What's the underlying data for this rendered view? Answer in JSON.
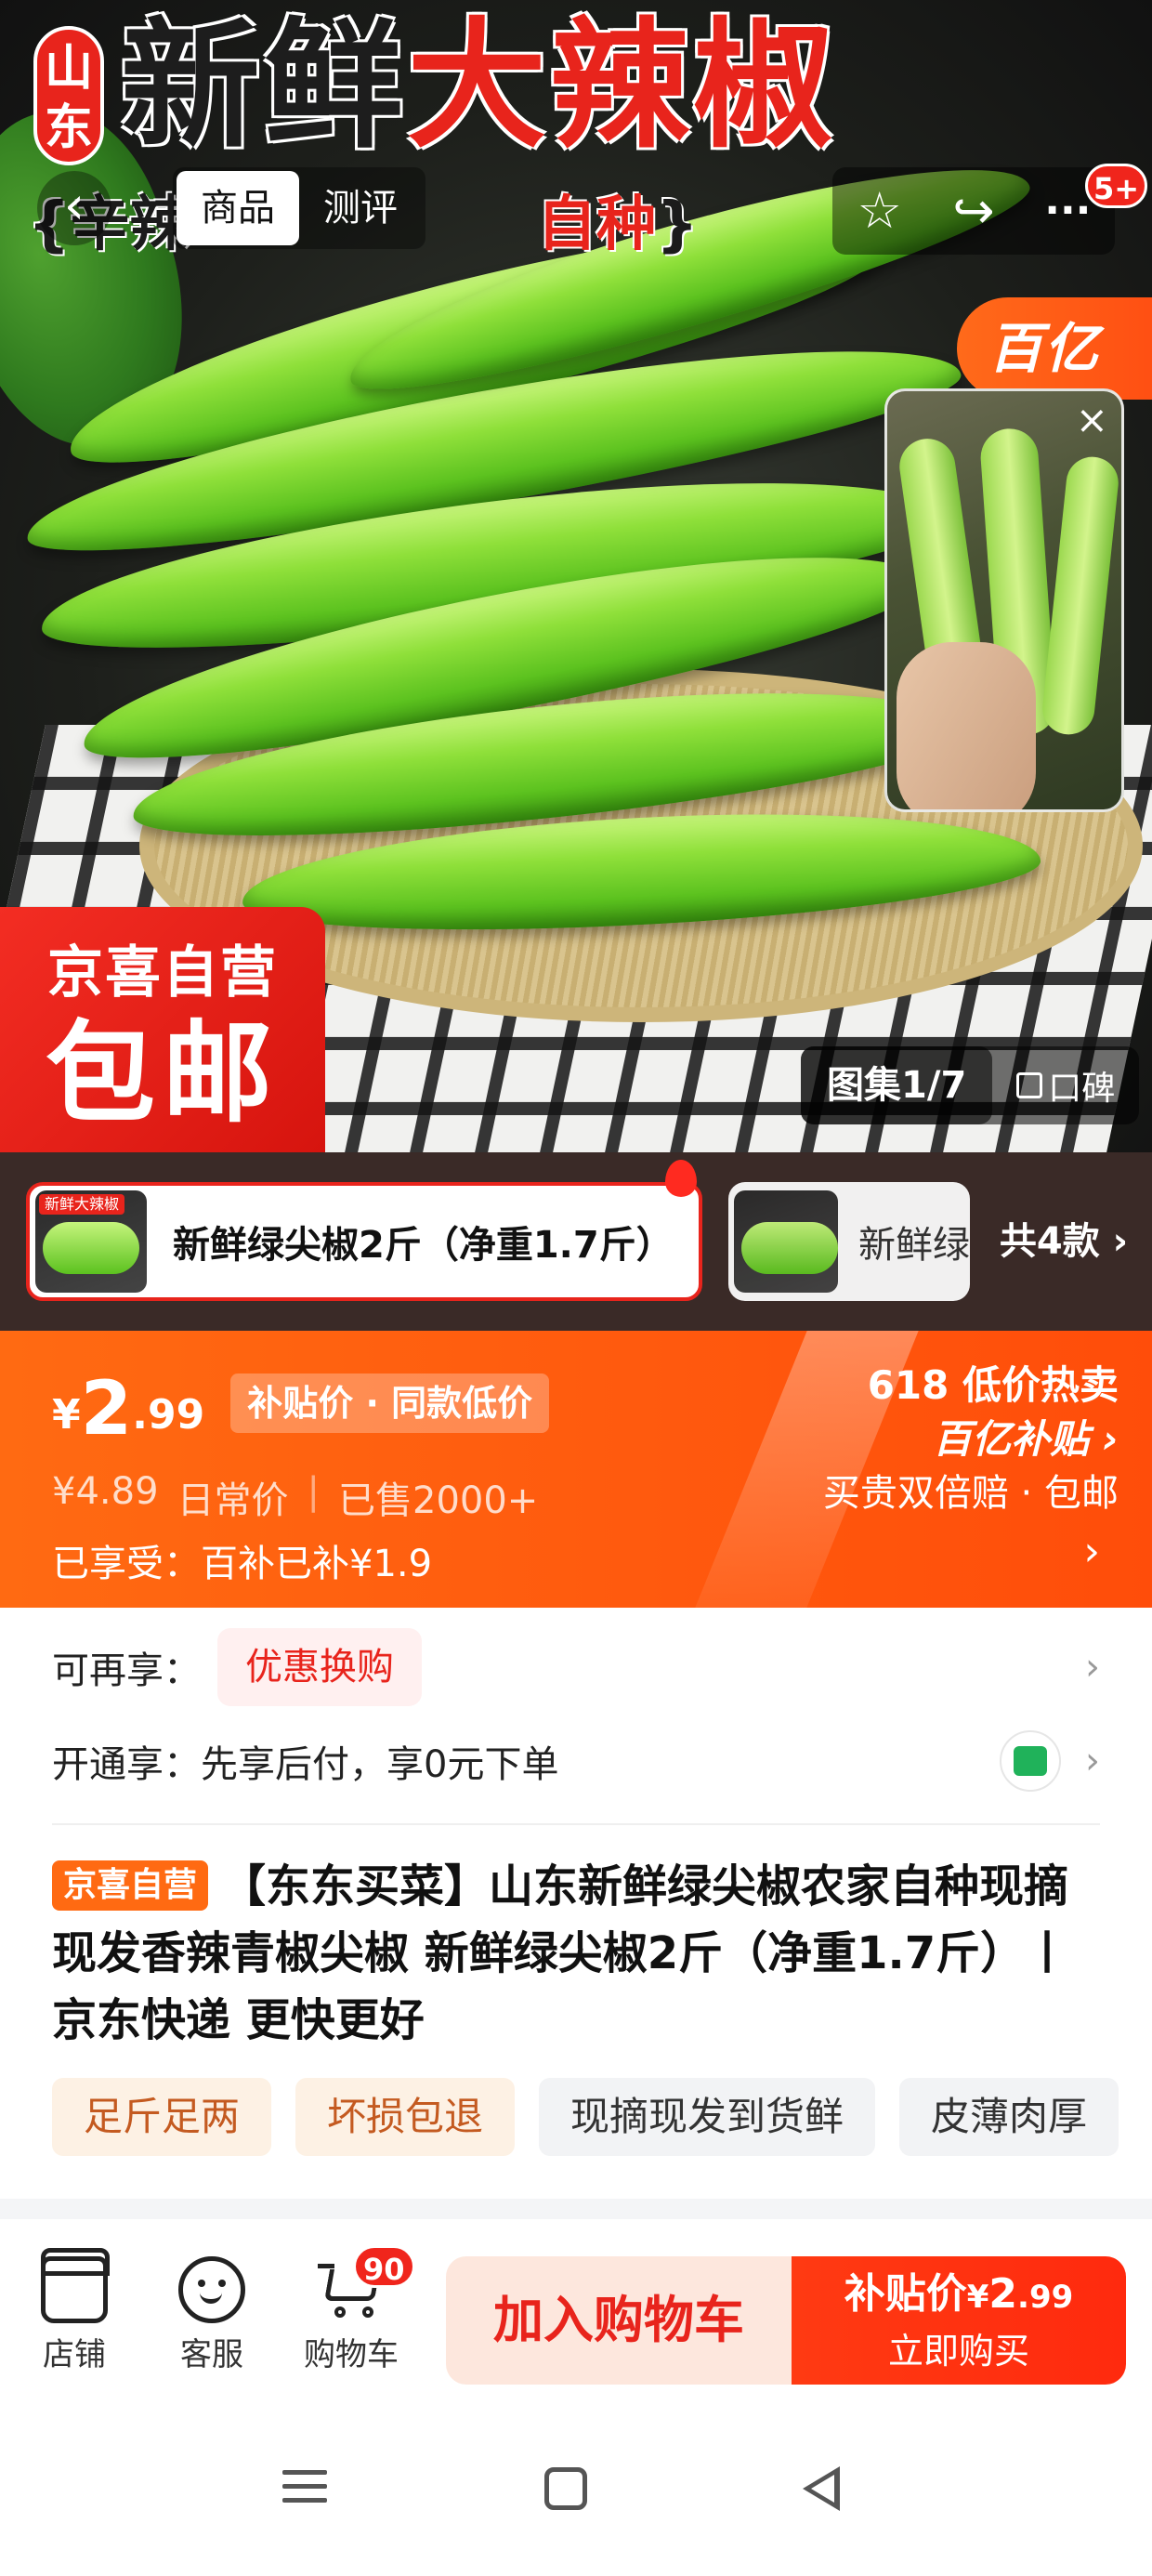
{
  "hero": {
    "origin": "山东",
    "title_black": "新鲜",
    "title_red": "大辣椒",
    "slogan_pre": "{辛辣",
    "slogan_red": "自种",
    "slogan_post": "}",
    "brand_flag": "百亿",
    "sticker_line1": "京喜自营",
    "sticker_line2": "包邮",
    "gallery_label": "图集1/7",
    "koubei_label": "口碑"
  },
  "nav": {
    "back_icon": "‹",
    "tabs": [
      "商品",
      "测评"
    ],
    "favorite_icon": "☆",
    "share_icon": "↪",
    "more_icon": "···",
    "more_badge": "5+",
    "video_close": "×"
  },
  "variants": {
    "active_label": "新鲜绿尖椒2斤（净重1.7斤）",
    "active_thumb_tag": "新鲜大辣椒",
    "other_label": "新鲜绿",
    "more_label": "共4款 ›"
  },
  "price": {
    "currency": "¥",
    "integer": "2",
    "decimal": ".99",
    "tag": "补贴价 · 同款低价",
    "old_price": "¥4.89",
    "old_price_label": "日常价",
    "sold": "已售2000+",
    "enjoyed": "已享受：百补已补¥1.9",
    "promo_line1": "618 低价热卖",
    "promo_line2": "百亿补贴 ›",
    "promo_line3": "买贵双倍赔 · 包邮",
    "chevron": "›"
  },
  "promos": {
    "row1_label": "可再享：",
    "row1_pill": "优惠换购",
    "row2_label": "开通享：先享后付，享0元下单",
    "chevron": "›"
  },
  "product": {
    "self_tag": "京喜自营",
    "title": "【东东买菜】山东新鲜绿尖椒农家自种现摘现发香辣青椒尖椒 新鲜绿尖椒2斤（净重1.7斤）丨京东快递 更快更好",
    "tags": [
      "足斤足两",
      "坏损包退",
      "现摘现发到货鲜",
      "皮薄肉厚"
    ]
  },
  "bottom": {
    "shop": "店铺",
    "service": "客服",
    "cart": "购物车",
    "cart_badge": "90",
    "add_to_cart": "加入购物车",
    "buy_price_label": "补贴价",
    "buy_price_currency": "¥",
    "buy_price_int": "2",
    "buy_price_dec": ".99",
    "buy_now": "立即购买"
  },
  "colors": {
    "accent_red": "#e8241c",
    "price_orange": "#ff5a0e",
    "pepper_green": "#8fe03a"
  }
}
